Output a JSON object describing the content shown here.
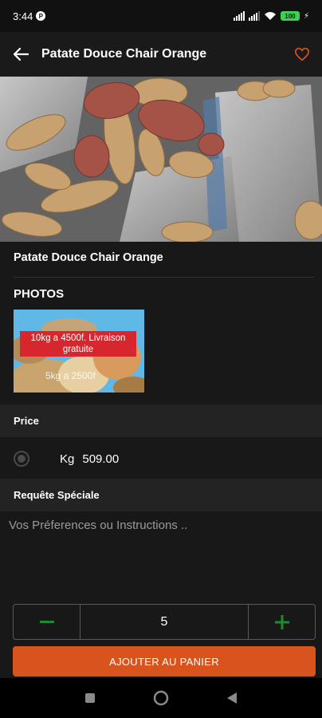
{
  "status": {
    "time": "3:44",
    "p_badge": "P",
    "battery": "100"
  },
  "header": {
    "title": "Patate Douce Chair Orange"
  },
  "product": {
    "name": "Patate Douce Chair Orange"
  },
  "photos": {
    "title": "PHOTOS",
    "thumb_banner": "10kg a 4500f. Livraison gratuite",
    "thumb_caption": "5kg a 2500f"
  },
  "price_section": {
    "title": "Price",
    "unit": "Kg",
    "value": "509.00"
  },
  "special_request": {
    "title": "Requête Spéciale",
    "placeholder": "Vos Préferences ou Instructions .."
  },
  "quantity": {
    "value": "5",
    "minus": "−",
    "plus": "+"
  },
  "cta": {
    "label": "AJOUTER AU PANIER"
  },
  "colors": {
    "accent": "#d9541d",
    "stepper_icon": "#1f8a2e",
    "background": "#181818"
  },
  "icons": [
    "back-arrow-icon",
    "heart-outline-icon",
    "minus-icon",
    "plus-icon",
    "square-nav-icon",
    "circle-nav-icon",
    "triangle-back-nav-icon"
  ]
}
